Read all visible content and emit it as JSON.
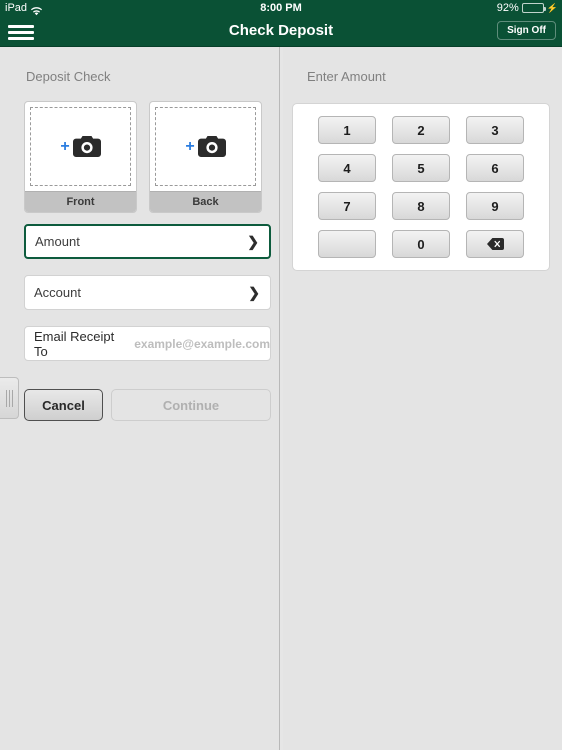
{
  "status_bar": {
    "device": "iPad",
    "wifi_icon": "wifi-icon",
    "time": "8:00 PM",
    "battery_percent": "92%",
    "battery_level": 92,
    "charging_icon": "lightning-bolt-icon"
  },
  "nav_bar": {
    "menu_icon": "hamburger-menu-icon",
    "title": "Check Deposit",
    "sign_off_label": "Sign Off"
  },
  "left_panel": {
    "heading": "Deposit Check",
    "captures": [
      {
        "label": "Front",
        "icon": "add-camera-icon"
      },
      {
        "label": "Back",
        "icon": "add-camera-icon"
      }
    ],
    "fields": [
      {
        "label": "Amount",
        "value": "",
        "active": true,
        "chevron": "❯"
      },
      {
        "label": "Account",
        "value": "",
        "active": false,
        "chevron": "❯"
      }
    ],
    "email_field": {
      "label": "Email Receipt To",
      "value": "",
      "placeholder": "example@example.com"
    },
    "buttons": {
      "cancel_label": "Cancel",
      "continue_label": "Continue",
      "continue_enabled": false
    },
    "drag_handle_icon": "drag-handle-icon"
  },
  "right_panel": {
    "heading": "Enter Amount",
    "keypad": [
      {
        "key": "1",
        "type": "digit"
      },
      {
        "key": "2",
        "type": "digit"
      },
      {
        "key": "3",
        "type": "digit"
      },
      {
        "key": "4",
        "type": "digit"
      },
      {
        "key": "5",
        "type": "digit"
      },
      {
        "key": "6",
        "type": "digit"
      },
      {
        "key": "7",
        "type": "digit"
      },
      {
        "key": "8",
        "type": "digit"
      },
      {
        "key": "9",
        "type": "digit"
      },
      {
        "key": "",
        "type": "blank"
      },
      {
        "key": "0",
        "type": "digit"
      },
      {
        "key": "",
        "type": "backspace"
      }
    ]
  },
  "colors": {
    "brand_green": "#0a5135",
    "accent_blue": "#2b7de0",
    "active_border_green": "#0d5b3d",
    "panel_background": "#e4e4e4",
    "battery_green": "#3ddc6a"
  }
}
